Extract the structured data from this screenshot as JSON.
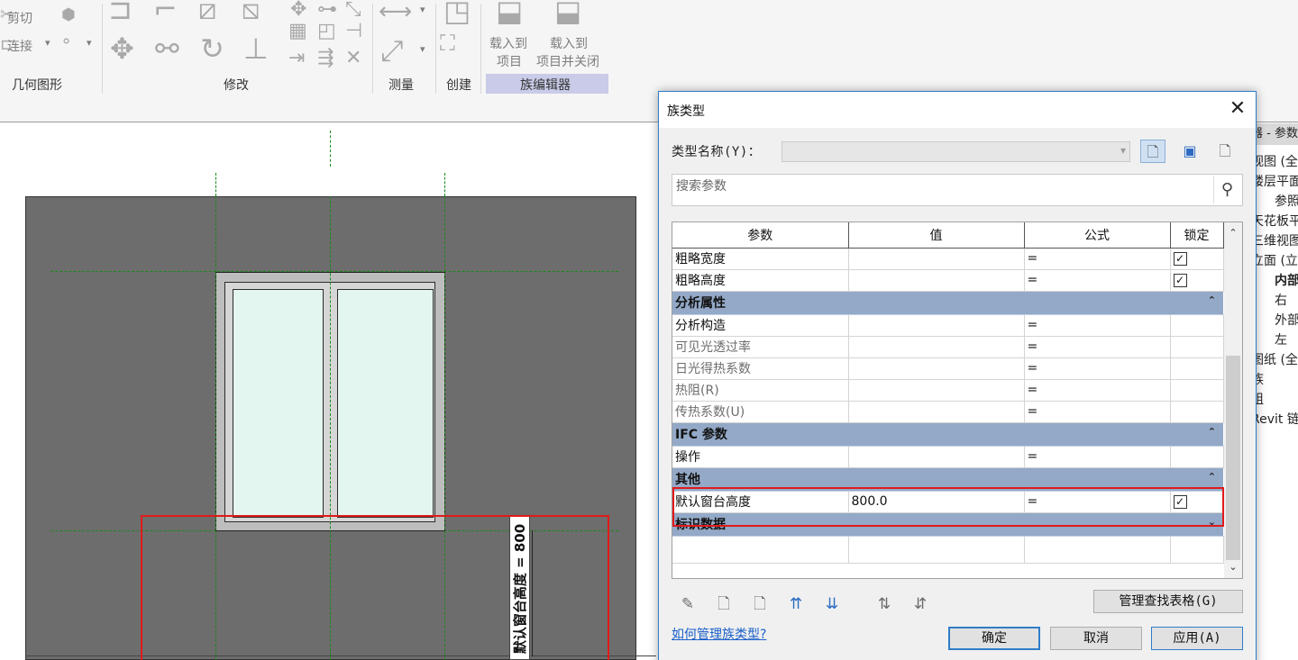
{
  "ribbon": {
    "cut_label": "剪切",
    "join_label": "连接",
    "panel_geometry": "几何图形",
    "panel_modify": "修改",
    "panel_measure": "测量",
    "panel_create": "创建",
    "panel_family_editor": "族编辑器",
    "load_into_project": [
      "载入到",
      "项目"
    ],
    "load_into_project_close": [
      "载入到",
      "项目并关闭"
    ]
  },
  "canvas": {
    "dimension_label": "默认窗台高度 = 800"
  },
  "project_browser": {
    "title": "器 - 参数",
    "items": [
      "视图 (全部)",
      "楼层平面",
      "参照",
      "天花板平",
      "三维视图",
      "立面 (立",
      "内部",
      "右",
      "外部",
      "左",
      "图纸 (全部",
      "族",
      "组",
      "Revit 链接"
    ]
  },
  "dialog": {
    "title": "族类型",
    "type_name_label": "类型名称(Y)：",
    "type_name_value": "",
    "search_placeholder": "搜索参数",
    "columns": [
      "参数",
      "值",
      "公式",
      "锁定"
    ],
    "rows_top": [
      {
        "name": "粗略宽度",
        "value": "",
        "formula": "=",
        "locked": true
      },
      {
        "name": "粗略高度",
        "value": "",
        "formula": "=",
        "locked": true
      }
    ],
    "group_analysis": "分析属性",
    "rows_analysis": [
      {
        "name": "分析构造",
        "value": "",
        "formula": "="
      },
      {
        "name": "可见光透过率",
        "value": "",
        "formula": "="
      },
      {
        "name": "日光得热系数",
        "value": "",
        "formula": "="
      },
      {
        "name": "热阻(R)",
        "value": "",
        "formula": "="
      },
      {
        "name": "传热系数(U)",
        "value": "",
        "formula": "="
      }
    ],
    "group_ifc": "IFC 参数",
    "rows_ifc": [
      {
        "name": "操作",
        "value": "",
        "formula": "="
      }
    ],
    "group_other": "其他",
    "rows_other": [
      {
        "name": "默认窗台高度",
        "value": "800.0",
        "formula": "=",
        "locked": true
      }
    ],
    "group_identity": "标识数据",
    "manage_lookup_tables": "管理查找表格(G)",
    "help_link": "如何管理族类型?",
    "ok": "确定",
    "cancel": "取消",
    "apply": "应用(A)"
  },
  "icons": {
    "close": "close-icon",
    "search": "search-icon",
    "check": "✓"
  },
  "colors": {
    "group_header": "#93a9c7",
    "highlight_red": "#e01a1a",
    "reference_plane_green": "#1a8a1a",
    "glass": "#e3f6ef",
    "wall": "#6d6d6d",
    "active_panel": "#c9cbe8"
  }
}
